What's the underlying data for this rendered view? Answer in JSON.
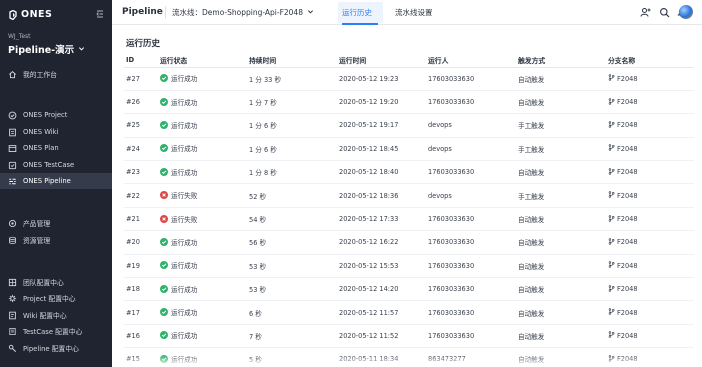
{
  "sidebar": {
    "brand": "ONES",
    "team": "WJ_Test",
    "project": "Pipeline-演示",
    "workspace": "我的工作台",
    "products": [
      {
        "label": "ONES Project",
        "icon": "check-circle-icon"
      },
      {
        "label": "ONES Wiki",
        "icon": "wiki-icon"
      },
      {
        "label": "ONES Plan",
        "icon": "plan-icon"
      },
      {
        "label": "ONES TestCase",
        "icon": "testcase-icon"
      },
      {
        "label": "ONES Pipeline",
        "icon": "pipeline-icon"
      }
    ],
    "manage": [
      {
        "label": "产品管理",
        "icon": "product-icon"
      },
      {
        "label": "资源管理",
        "icon": "resource-icon"
      }
    ],
    "config": [
      {
        "label": "团队配置中心",
        "icon": "team-config-icon"
      },
      {
        "label": "Project 配置中心",
        "icon": "project-config-icon"
      },
      {
        "label": "Wiki 配置中心",
        "icon": "wiki-config-icon"
      },
      {
        "label": "TestCase 配置中心",
        "icon": "testcase-config-icon"
      },
      {
        "label": "Pipeline 配置中心",
        "icon": "pipeline-config-icon"
      }
    ]
  },
  "header": {
    "app": "Pipeline",
    "pipeline_selector": "流水线：Demo-Shopping-Api-F2048",
    "tabs": [
      "运行历史",
      "流水线设置"
    ],
    "active_tab": "运行历史"
  },
  "main": {
    "title": "运行历史",
    "columns": [
      "ID",
      "运行状态",
      "持续时间",
      "运行时间",
      "运行人",
      "触发方式",
      "分支名称"
    ],
    "rows": [
      {
        "id": "#27",
        "status": "运行成功",
        "ok": true,
        "duration": "1 分 33 秒",
        "time": "2020-05-12 19:23",
        "user": "17603033630",
        "trigger": "自动触发",
        "branch": "F2048"
      },
      {
        "id": "#26",
        "status": "运行成功",
        "ok": true,
        "duration": "1 分 7 秒",
        "time": "2020-05-12 19:20",
        "user": "17603033630",
        "trigger": "自动触发",
        "branch": "F2048"
      },
      {
        "id": "#25",
        "status": "运行成功",
        "ok": true,
        "duration": "1 分 6 秒",
        "time": "2020-05-12 19:17",
        "user": "devops",
        "trigger": "手工触发",
        "branch": "F2048"
      },
      {
        "id": "#24",
        "status": "运行成功",
        "ok": true,
        "duration": "1 分 6 秒",
        "time": "2020-05-12 18:45",
        "user": "devops",
        "trigger": "手工触发",
        "branch": "F2048"
      },
      {
        "id": "#23",
        "status": "运行成功",
        "ok": true,
        "duration": "1 分 8 秒",
        "time": "2020-05-12 18:40",
        "user": "17603033630",
        "trigger": "自动触发",
        "branch": "F2048"
      },
      {
        "id": "#22",
        "status": "运行失败",
        "ok": false,
        "duration": "52 秒",
        "time": "2020-05-12 18:36",
        "user": "devops",
        "trigger": "手工触发",
        "branch": "F2048"
      },
      {
        "id": "#21",
        "status": "运行失败",
        "ok": false,
        "duration": "54 秒",
        "time": "2020-05-12 17:33",
        "user": "17603033630",
        "trigger": "自动触发",
        "branch": "F2048"
      },
      {
        "id": "#20",
        "status": "运行成功",
        "ok": true,
        "duration": "56 秒",
        "time": "2020-05-12 16:22",
        "user": "17603033630",
        "trigger": "自动触发",
        "branch": "F2048"
      },
      {
        "id": "#19",
        "status": "运行成功",
        "ok": true,
        "duration": "53 秒",
        "time": "2020-05-12 15:53",
        "user": "17603033630",
        "trigger": "自动触发",
        "branch": "F2048"
      },
      {
        "id": "#18",
        "status": "运行成功",
        "ok": true,
        "duration": "53 秒",
        "time": "2020-05-12 14:20",
        "user": "17603033630",
        "trigger": "自动触发",
        "branch": "F2048"
      },
      {
        "id": "#17",
        "status": "运行成功",
        "ok": true,
        "duration": "6 秒",
        "time": "2020-05-12 11:57",
        "user": "17603033630",
        "trigger": "自动触发",
        "branch": "F2048"
      },
      {
        "id": "#16",
        "status": "运行成功",
        "ok": true,
        "duration": "7 秒",
        "time": "2020-05-12 11:52",
        "user": "17603033630",
        "trigger": "自动触发",
        "branch": "F2048"
      },
      {
        "id": "#15",
        "status": "运行成功",
        "ok": true,
        "duration": "5 秒",
        "time": "2020-05-11 18:34",
        "user": "863473277",
        "trigger": "自动触发",
        "branch": "F2048"
      }
    ]
  },
  "colors": {
    "sidebar_bg": "#1f2430",
    "accent": "#2b7ff2",
    "success": "#2fb36a",
    "failure": "#e04545"
  }
}
